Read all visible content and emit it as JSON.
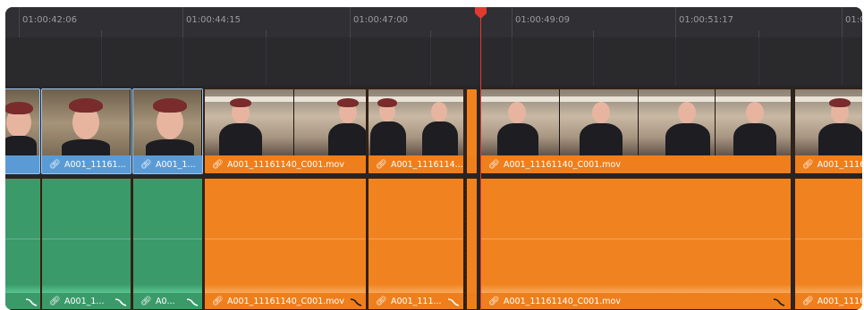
{
  "timeline": {
    "timecodes": [
      "01:00:42:06",
      "01:00:44:15",
      "01:00:47:00",
      "01:00:49:09",
      "01:00:51:17",
      "01:0"
    ],
    "playhead_color": "#e23a2f",
    "colors": {
      "blue_clip": "#5b9bd5",
      "orange_clip": "#f0831f",
      "green_audio": "#3a9a6a",
      "background": "#2b2b2e"
    }
  },
  "video_clips": [
    {
      "label": "",
      "color": "blue",
      "thumb": "closeup"
    },
    {
      "label": "A001_11161...",
      "color": "blue",
      "thumb": "closeup"
    },
    {
      "label": "A001_1...",
      "color": "blue",
      "thumb": "closeup"
    },
    {
      "label": "A001_11161140_C001.mov",
      "color": "orange",
      "thumb": "kitchen"
    },
    {
      "label": "A001_1116114...",
      "color": "orange",
      "thumb": "kitchen"
    },
    {
      "label": "",
      "color": "orange",
      "thumb": "none"
    },
    {
      "label": "A001_11161140_C001.mov",
      "color": "orange",
      "thumb": "kitchen"
    },
    {
      "label": "A001_1116",
      "color": "orange",
      "thumb": "kitchen"
    }
  ],
  "audio_clips": [
    {
      "label": "",
      "color": "green"
    },
    {
      "label": "A001_1...",
      "color": "green"
    },
    {
      "label": "A0...",
      "color": "green"
    },
    {
      "label": "A001_11161140_C001.mov",
      "color": "orange"
    },
    {
      "label": "A001_111...",
      "color": "orange"
    },
    {
      "label": "",
      "color": "orange"
    },
    {
      "label": "A001_11161140_C001.mov",
      "color": "orange"
    },
    {
      "label": "A001_1116",
      "color": "orange"
    }
  ],
  "icons": {
    "link": "link-icon",
    "fade": "fade-handle-icon",
    "playhead": "playhead-icon"
  }
}
